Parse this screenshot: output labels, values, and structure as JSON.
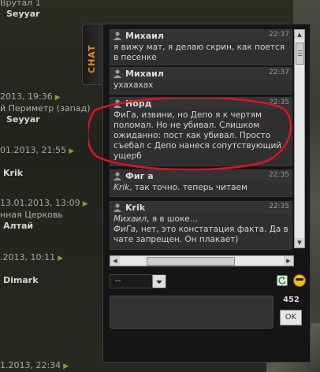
{
  "background": {
    "entries": [
      {
        "meta": "Врутал 1",
        "arrow": false,
        "location": "",
        "user": "Seyyar"
      },
      {
        "meta": "2013, 19:36",
        "arrow": true,
        "location": "й Периметр (запад)",
        "user": "Seyyar"
      },
      {
        "meta": "01.2013, 21:55",
        "arrow": true,
        "location": "",
        "user": "Krik"
      },
      {
        "meta": "13.01.2013, 13:09",
        "arrow": true,
        "location": "нная Церковь",
        "user": "Алтай"
      },
      {
        "meta": ".2013, 10:11",
        "arrow": true,
        "location": "",
        "user": "Dimark"
      },
      {
        "meta": "1.2013, 22:34",
        "arrow": true,
        "location": "",
        "user": ""
      }
    ]
  },
  "chat": {
    "tab_label": "CHAT",
    "messages": [
      {
        "author": "Михаил",
        "time": "22:37",
        "text": "я вижу мат, я делаю скрин, как поется в песенке"
      },
      {
        "author": "Михаил",
        "time": "22:37",
        "text": "ухахахах"
      },
      {
        "author": "Норд",
        "time": "22:35",
        "text": "ФиГа, извини, но Депо я к чертям поломал. Но не убивал. Слишком ожиданно: пост как убивал. Просто съебал с Депо нанеся сопутствующий ущерб"
      },
      {
        "author": "Фиг а",
        "time": "22:35",
        "mention": "Krik",
        "text": ", так точно. теперь читаем"
      },
      {
        "author": "Krik",
        "time": "22:35",
        "line1_mention": "Михаил",
        "line1_text": ", я в шоке...",
        "line2_mention": "ФиГа",
        "line2_text": ", нет, это констатация факта. Да в чате запрещен. Он плакает)"
      }
    ],
    "channel_select": {
      "value": "--"
    },
    "input": {
      "value": "",
      "placeholder": ""
    },
    "char_counter": "452",
    "send_label": "OK"
  },
  "colors": {
    "annotation": "#e0141a",
    "tab_text": "#e08a1a",
    "arrow": "#7aa43a"
  },
  "icons": [
    "person-icon",
    "refresh-icon",
    "smiley-icon",
    "chevron-down-icon",
    "scroll-arrow-icon"
  ]
}
